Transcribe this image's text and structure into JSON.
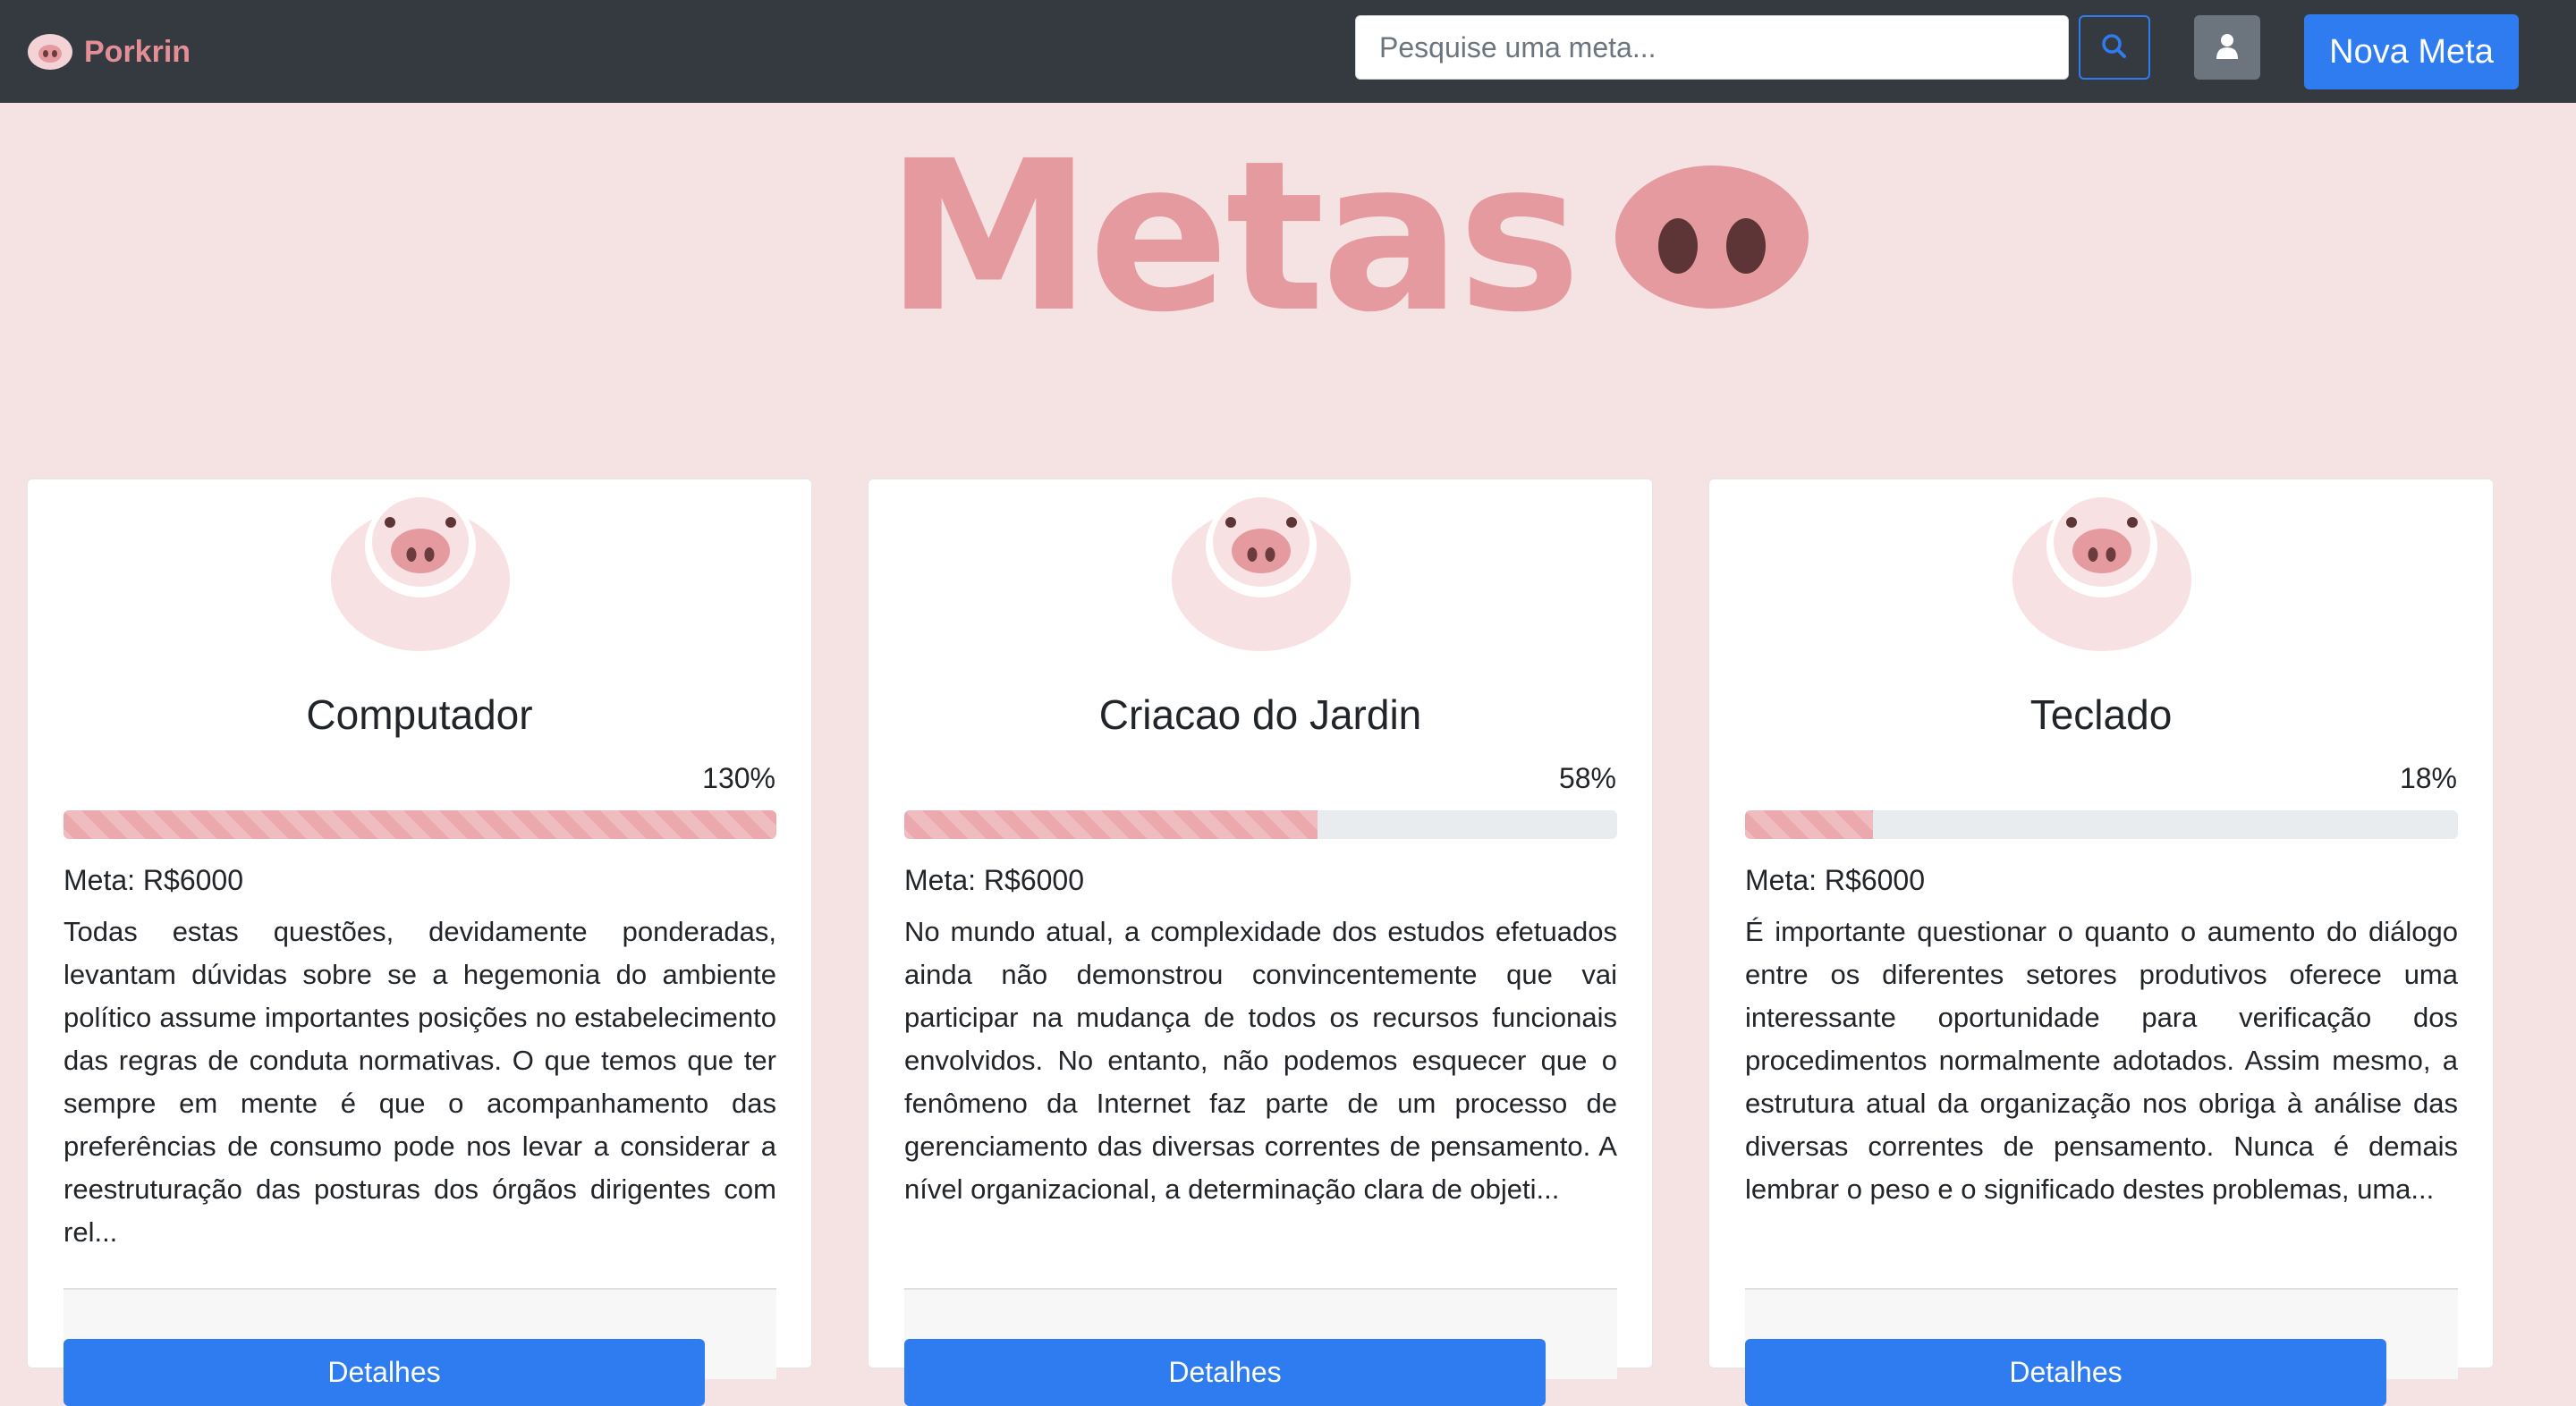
{
  "navbar": {
    "brand": "Porkrin",
    "search_placeholder": "Pesquise uma meta...",
    "new_goal_label": "Nova Meta"
  },
  "hero": {
    "title": "Metas"
  },
  "colors": {
    "navbar_bg": "#343a40",
    "page_bg": "#f5e3e4",
    "accent_pink": "#e59aa0",
    "primary_blue": "#2f7cf0"
  },
  "cards": [
    {
      "title": "Computador",
      "percent_label": "130%",
      "progress_percent": 100,
      "goal": "Meta: R$6000",
      "description": "Todas estas questões, devidamente ponderadas, levantam dúvidas sobre se a hegemonia do ambiente político assume importantes posições no estabelecimento das regras de conduta normativas. O que temos que ter sempre em mente é que o acompanhamento das preferências de consumo pode nos levar a considerar a reestruturação das posturas dos órgãos dirigentes com rel...",
      "button": "Detalhes"
    },
    {
      "title": "Criacao do Jardin",
      "percent_label": "58%",
      "progress_percent": 58,
      "goal": "Meta: R$6000",
      "description": "No mundo atual, a complexidade dos estudos efetuados ainda não demonstrou convincentemente que vai participar na mudança de todos os recursos funcionais envolvidos. No entanto, não podemos esquecer que o fenômeno da Internet faz parte de um processo de gerenciamento das diversas correntes de pensamento. A nível organizacional, a determinação clara de objeti...",
      "button": "Detalhes"
    },
    {
      "title": "Teclado",
      "percent_label": "18%",
      "progress_percent": 18,
      "goal": "Meta: R$6000",
      "description": "É importante questionar o quanto o aumento do diálogo entre os diferentes setores produtivos oferece uma interessante oportunidade para verificação dos procedimentos normalmente adotados. Assim mesmo, a estrutura atual da organização nos obriga à análise das diversas correntes de pensamento. Nunca é demais lembrar o peso e o significado destes problemas, uma...",
      "button": "Detalhes"
    }
  ]
}
